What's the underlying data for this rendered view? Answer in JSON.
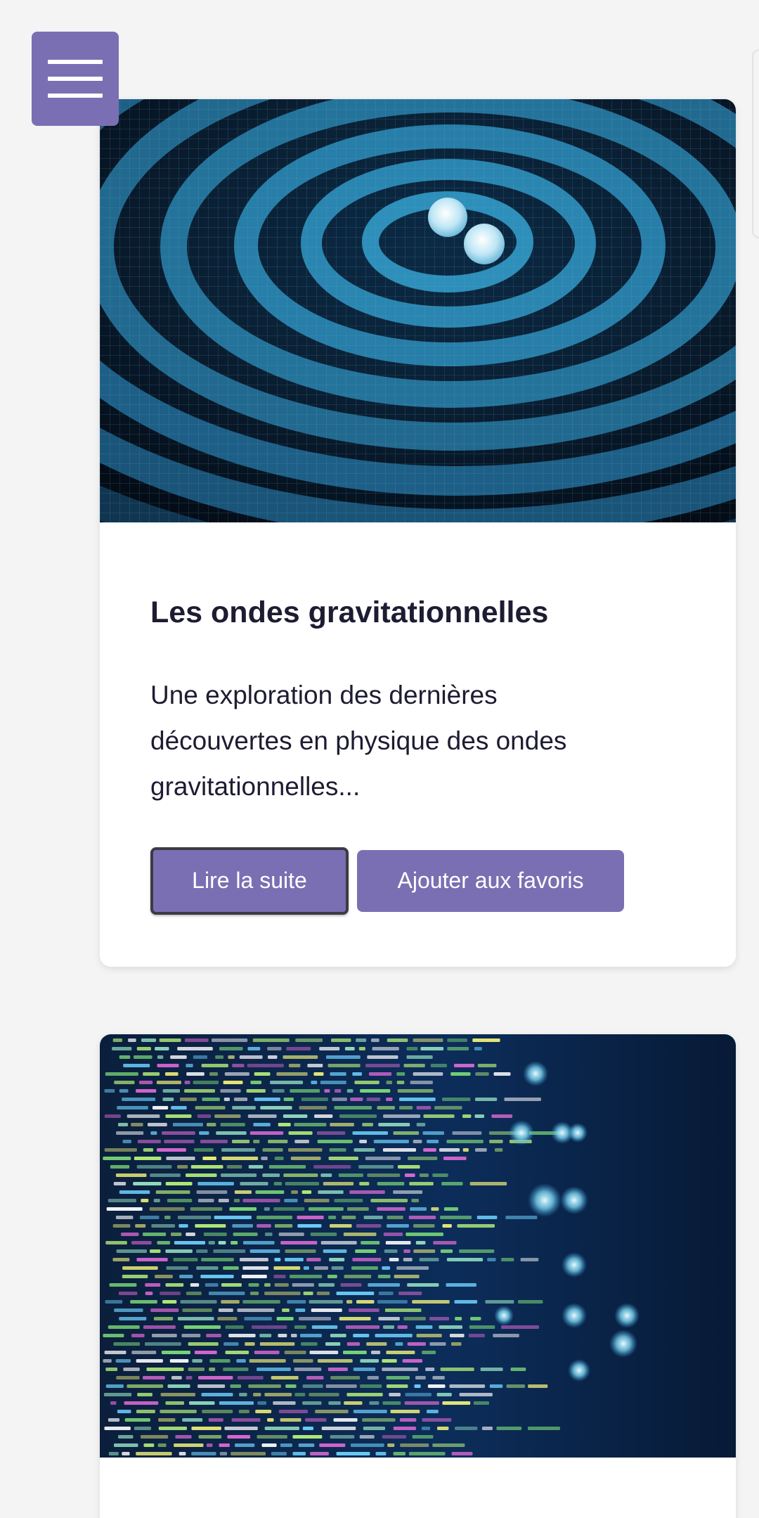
{
  "menu": {
    "icon": "hamburger-icon",
    "color": "#7b6fb3"
  },
  "cards": [
    {
      "image_subject": "gravitational-waves-illustration",
      "title": "Les ondes gravitationnelles",
      "description": "Une exploration des dernières découvertes en physique des ondes gravitationnelles...",
      "read_more_label": "Lire la suite",
      "favorite_label": "Ajouter aux favoris"
    },
    {
      "image_subject": "code-on-screen-illustration"
    }
  ],
  "colors": {
    "accent": "#7b6fb3",
    "page_background": "#f4f4f4",
    "text": "#1d1c32"
  }
}
